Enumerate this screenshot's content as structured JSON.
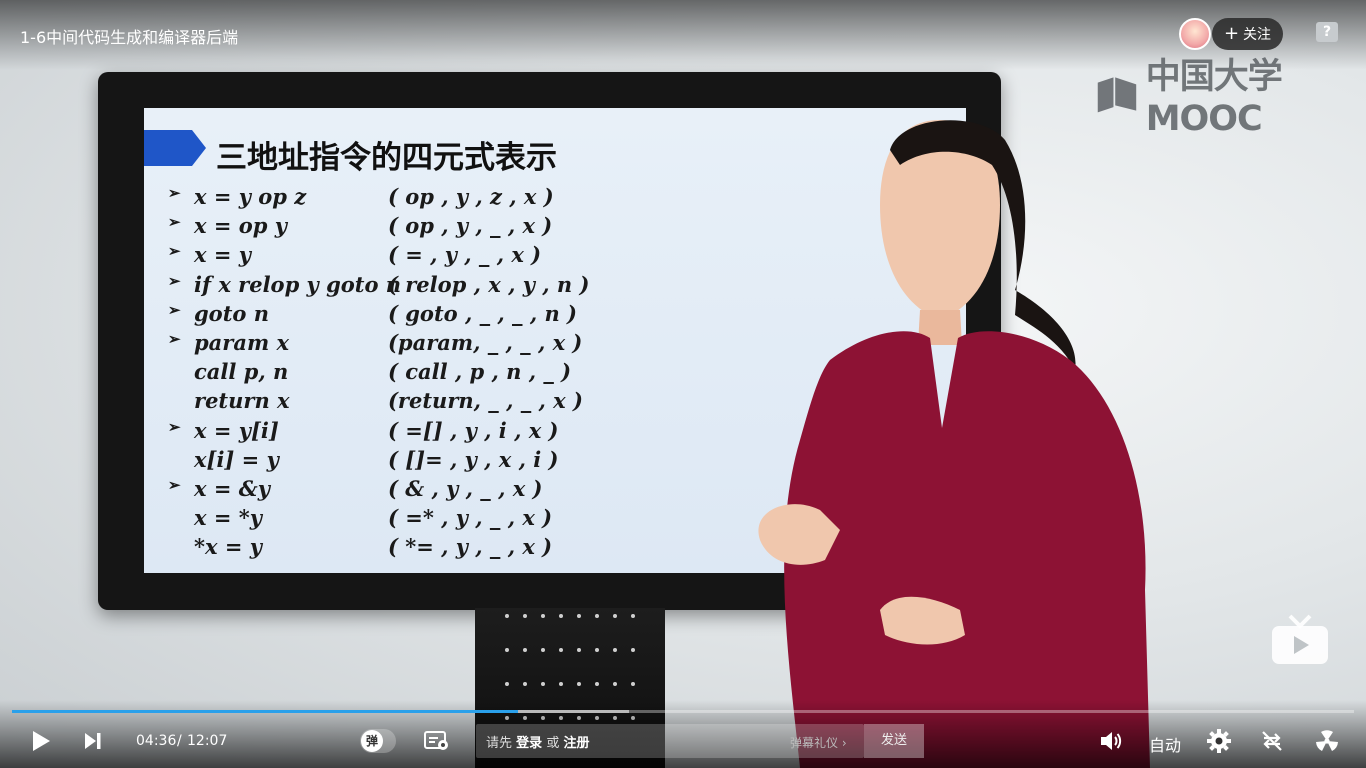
{
  "header": {
    "title": "1-6中间代码生成和编译器后端",
    "follow_label": "关注",
    "follow_plus": "+",
    "help_label": "?",
    "watermark": "中国大学MOOC"
  },
  "slide": {
    "title": "三地址指令的四元式表示",
    "rows": [
      {
        "bullet": "➢",
        "instr": "x = y op z",
        "quad": "(   op    , y  , z  , x )"
      },
      {
        "bullet": "➢",
        "instr": "x = op y",
        "quad": "(   op    , y  , _  , x )"
      },
      {
        "bullet": "➢",
        "instr": "x = y",
        "quad": "(    =     , y  , _  , x )"
      },
      {
        "bullet": "➢",
        "instr": "if x relop y goto n",
        "quad": "( relop , x  , y  , n )"
      },
      {
        "bullet": "➢",
        "instr": "goto n",
        "quad": "( goto  , _  , _  , n )"
      },
      {
        "bullet": "➢",
        "instr": "param x",
        "quad": "(param, _  , _  , x )"
      },
      {
        "bullet": "",
        "instr": "call p, n",
        "quad": "(  call   , p  , n  , _ )"
      },
      {
        "bullet": "",
        "instr": "return  x",
        "quad": "(return, _  , _  , x )"
      },
      {
        "bullet": "➢",
        "instr": "x = y[i]",
        "quad": "(   =[]   , y  , i  , x )"
      },
      {
        "bullet": "",
        "instr": "x[i] = y",
        "quad": "(   []=   , y  , x  , i )"
      },
      {
        "bullet": "➢",
        "instr": "x = &y",
        "quad": "(    &     , y  , _  , x )"
      },
      {
        "bullet": "",
        "instr": "x = *y",
        "quad": "(   =*    , y  , _  , x )"
      },
      {
        "bullet": "",
        "instr": "*x = y",
        "quad": "(   *=    , y  , _  , x )"
      }
    ]
  },
  "player": {
    "progress": 0.377,
    "buffered": 0.46,
    "time_current": "04:36",
    "time_sep": "/",
    "time_total": "12:07",
    "danmaku_toggle": "弹",
    "danmaku_prompt_1": "请先",
    "danmaku_login": "登录",
    "danmaku_or": "或",
    "danmaku_register": "注册",
    "danmaku_etiquette": "弹幕礼仪 ›",
    "send_label": "发送",
    "quality_label": "自动",
    "accent_color": "#2aa0ea"
  },
  "icons": {
    "play": "play-icon",
    "next": "next-icon",
    "danmaku_settings": "danmaku-settings-icon",
    "volume": "volume-icon",
    "settings": "gear-icon",
    "loop": "loop-off-icon",
    "fullscreen": "fullscreen-icon",
    "tv": "tv-icon"
  }
}
